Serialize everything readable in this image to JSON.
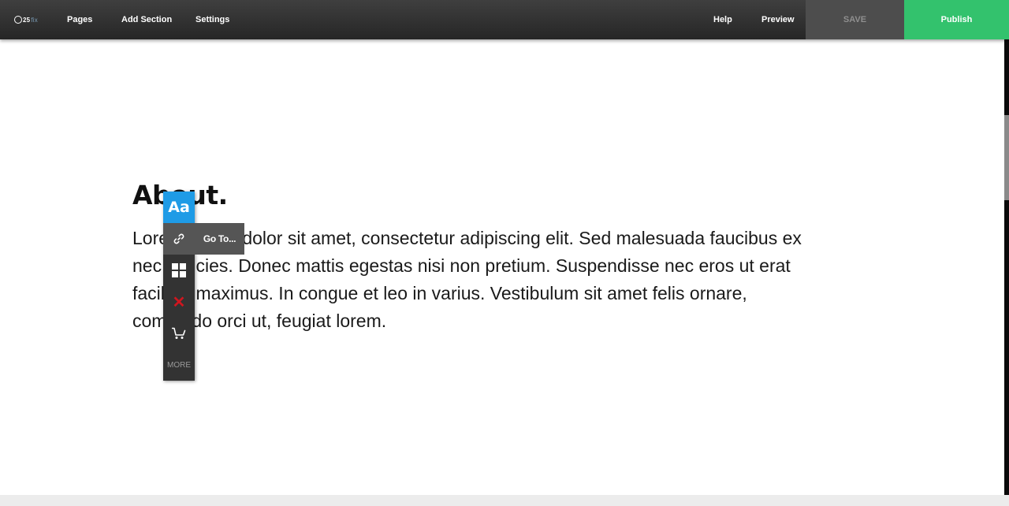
{
  "topbar": {
    "logo_text": "25",
    "logo_sub": "fix",
    "nav": {
      "pages": "Pages",
      "add_section": "Add Section",
      "settings": "Settings",
      "help": "Help",
      "preview": "Preview"
    },
    "save_label": "SAVE",
    "publish_label": "Publish"
  },
  "section": {
    "heading": "About.",
    "body": "Lorem ipsum dolor sit amet, consectetur adipiscing elit. Sed malesuada faucibus ex nec ultricies. Donec mattis egestas nisi non pretium. Suspendisse nec eros ut erat facilisis maximus. In congue et leo in varius. Vestibulum sit amet felis ornare, commodo orci ut, feugiat lorem."
  },
  "edit_toolbar": {
    "font_label": "Aa",
    "delete_symbol": "✕",
    "more_label": "MORE",
    "goto_tooltip": "Go To...",
    "icons": [
      "font-icon",
      "link-icon",
      "layout-grid-icon",
      "delete-icon",
      "cart-icon"
    ]
  },
  "colors": {
    "publish": "#33c26d",
    "font_button": "#1e9be6",
    "delete": "#d0161f",
    "toolbar": "#333333"
  }
}
